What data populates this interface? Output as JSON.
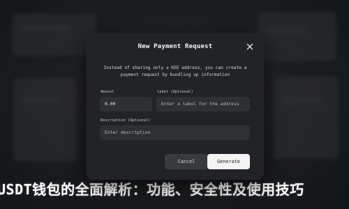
{
  "background": {
    "headline": "USDT钱包的全面解析：功能、安全性及使用技巧"
  },
  "modal": {
    "title": "New Payment Request",
    "close_icon": "close-icon",
    "description": "Instead of sharing only a KEE address, you can create a payment request by bundling up information",
    "amount": {
      "label": "Amount",
      "value": "0.00"
    },
    "label_field": {
      "label": "label (Optional)",
      "placeholder": "Enter a label for the address"
    },
    "description_field": {
      "label": "Description (Optional)",
      "placeholder": "Enter description"
    },
    "cancel_label": "Cancel",
    "generate_label": "Generate"
  },
  "colors": {
    "modal_bg": "#222326",
    "field_bg": "#2f3034",
    "primary_button_bg": "#f3f3f4",
    "secondary_button_bg": "#393a3e"
  }
}
